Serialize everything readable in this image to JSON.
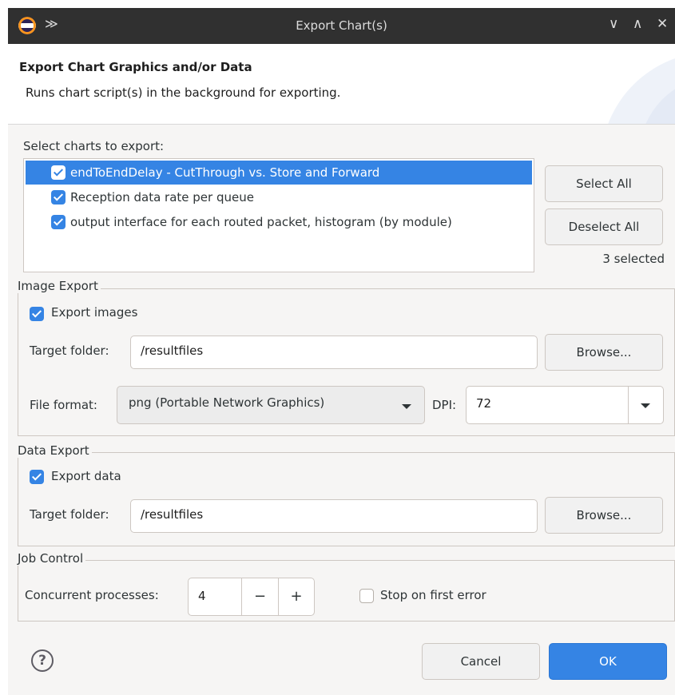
{
  "window": {
    "title": "Export Chart(s)",
    "controls": {
      "pin": "≫",
      "minimize": "∨",
      "maximize": "∧",
      "close": "✕"
    }
  },
  "banner": {
    "heading": "Export Chart Graphics and/or Data",
    "description": "Runs chart script(s) in the background for exporting."
  },
  "charts": {
    "label": "Select charts to export:",
    "items": [
      {
        "label": "endToEndDelay - CutThrough vs. Store and Forward",
        "checked": true,
        "selected": true
      },
      {
        "label": "Reception data rate per queue",
        "checked": true,
        "selected": false
      },
      {
        "label": "output interface for each routed packet, histogram (by module)",
        "checked": true,
        "selected": false
      }
    ],
    "select_all": "Select All",
    "deselect_all": "Deselect All",
    "selected_count": "3 selected"
  },
  "image_export": {
    "group_label": "Image Export",
    "checkbox_label": "Export images",
    "checked": true,
    "target_folder_label": "Target folder:",
    "target_folder_value": "/resultfiles",
    "browse": "Browse...",
    "file_format_label": "File format:",
    "file_format_value": "png (Portable Network Graphics)",
    "dpi_label": "DPI:",
    "dpi_value": "72"
  },
  "data_export": {
    "group_label": "Data Export",
    "checkbox_label": "Export data",
    "checked": true,
    "target_folder_label": "Target folder:",
    "target_folder_value": "/resultfiles",
    "browse": "Browse..."
  },
  "job_control": {
    "group_label": "Job Control",
    "concurrent_label": "Concurrent processes:",
    "concurrent_value": "4",
    "minus": "−",
    "plus": "+",
    "stop_label": "Stop on first error",
    "stop_checked": false
  },
  "footer": {
    "help": "?",
    "cancel": "Cancel",
    "ok": "OK"
  },
  "colors": {
    "accent": "#3584e4",
    "titlebar": "#303030",
    "dialog_bg": "#f6f5f4"
  }
}
